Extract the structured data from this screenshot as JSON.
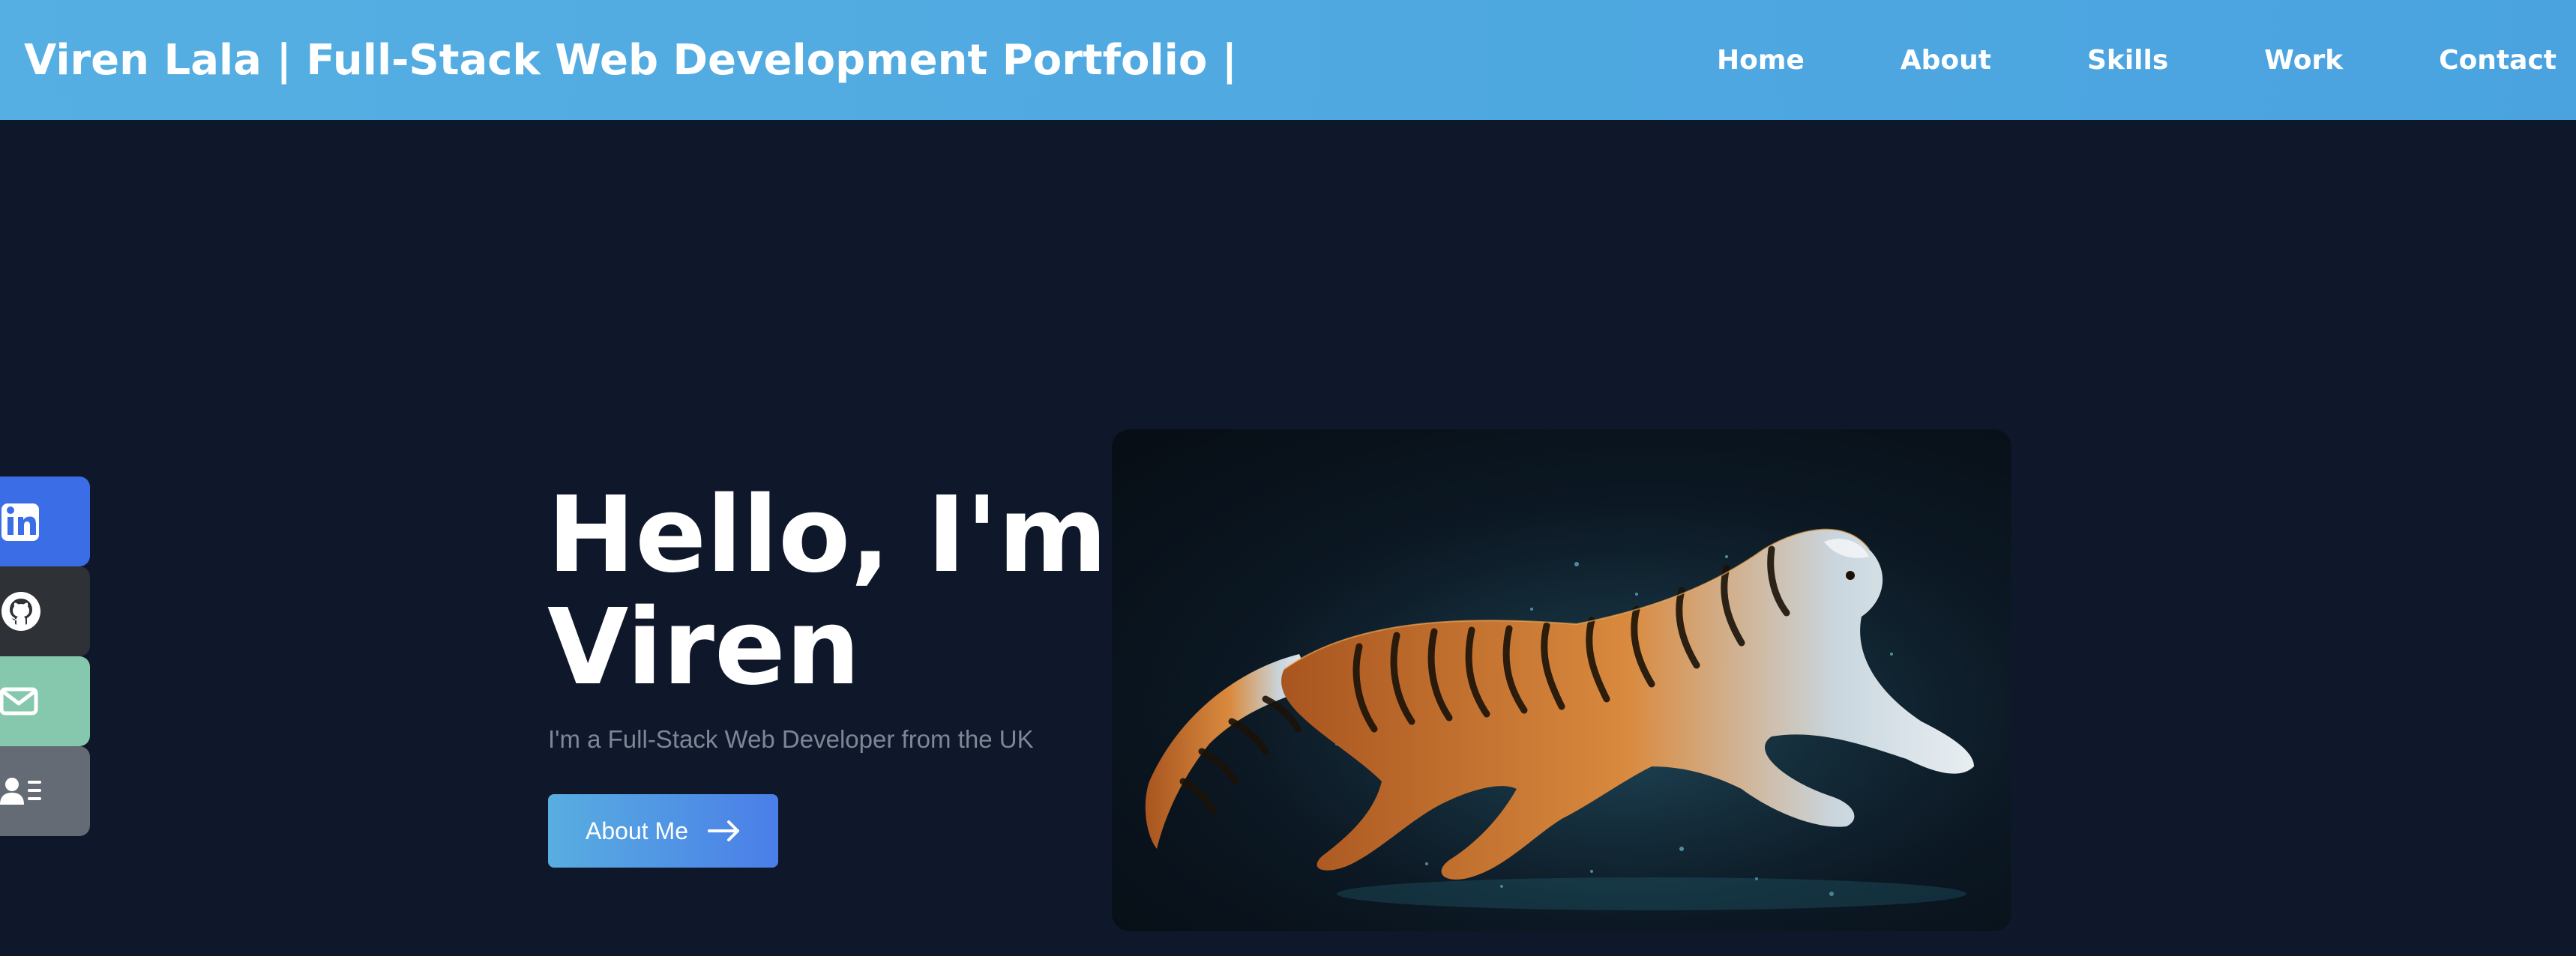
{
  "header": {
    "brand": "Viren Lala | Full-Stack Web Development Portfolio |",
    "nav": [
      "Home",
      "About",
      "Skills",
      "Work",
      "Contact"
    ]
  },
  "social": {
    "items": [
      {
        "icon": "linkedin-icon",
        "color": "#3b6ee6"
      },
      {
        "icon": "github-icon",
        "color": "#2e3136"
      },
      {
        "icon": "mail-icon",
        "color": "#86c8ad"
      },
      {
        "icon": "resume-icon",
        "color": "#646b75"
      }
    ]
  },
  "hero": {
    "title_line1": "Hello, I'm",
    "title_line2": "Viren",
    "subtitle": "I'm a Full-Stack Web Developer from the UK",
    "button_label": "About Me",
    "image_alt": "Glowing tiger leaping"
  },
  "colors": {
    "header_gradient_start": "#55afe2",
    "header_gradient_end": "#4aa3df",
    "page_background": "#0f172a",
    "button_gradient_start": "#58aee0",
    "button_gradient_end": "#4a7ee8"
  }
}
